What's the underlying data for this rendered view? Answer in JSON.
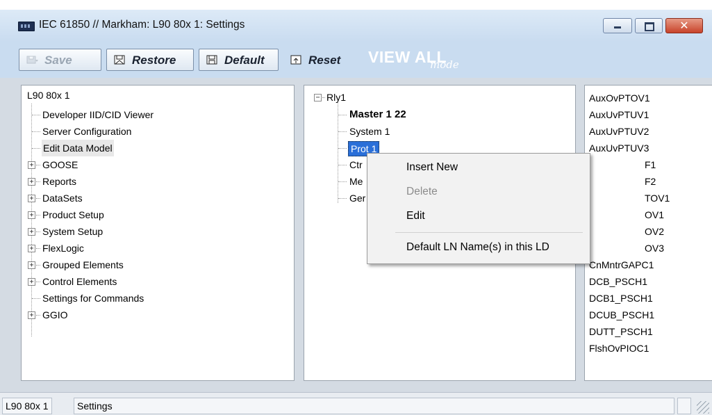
{
  "window": {
    "title": "IEC 61850 // Markham: L90 80x 1: Settings"
  },
  "toolbar": {
    "save": "Save",
    "restore": "Restore",
    "default": "Default",
    "reset": "Reset",
    "viewall_big": "VIEW ALL",
    "viewall_small": "mode"
  },
  "left_tree": {
    "root": "L90 80x 1",
    "items": [
      {
        "label": "Developer IID/CID Viewer",
        "expandable": false
      },
      {
        "label": "Server Configuration",
        "expandable": false
      },
      {
        "label": "Edit Data Model",
        "expandable": false,
        "selected": true
      },
      {
        "label": "GOOSE",
        "expandable": true
      },
      {
        "label": "Reports",
        "expandable": true
      },
      {
        "label": "DataSets",
        "expandable": true
      },
      {
        "label": "Product Setup",
        "expandable": true
      },
      {
        "label": "System Setup",
        "expandable": true
      },
      {
        "label": "FlexLogic",
        "expandable": true
      },
      {
        "label": "Grouped Elements",
        "expandable": true
      },
      {
        "label": "Control Elements",
        "expandable": true
      },
      {
        "label": "Settings for Commands",
        "expandable": false
      },
      {
        "label": "GGIO",
        "expandable": true
      }
    ]
  },
  "mid_tree": {
    "root": "Rly1",
    "items": [
      {
        "label": "Master  1 22",
        "style": "bold"
      },
      {
        "label": "System  1",
        "style": "normal"
      },
      {
        "label": "Prot  1",
        "style": "selected"
      },
      {
        "label": "Ctr",
        "style": "normal"
      },
      {
        "label": "Me",
        "style": "normal"
      },
      {
        "label": "Ger",
        "style": "normal"
      }
    ]
  },
  "right_list": {
    "items": [
      "AuxOvPTOV1",
      "AuxUvPTUV1",
      "AuxUvPTUV2",
      "AuxUvPTUV3",
      "F1",
      "F2",
      "TOV1",
      "OV1",
      "OV2",
      "OV3",
      "CnMntrGAPC1",
      "DCB_PSCH1",
      "DCB1_PSCH1",
      "DCUB_PSCH1",
      "DUTT_PSCH1",
      "FlshOvPIOC1"
    ]
  },
  "context_menu": {
    "insert_new": "Insert New",
    "delete": "Delete",
    "edit": "Edit",
    "default_ln": "Default LN Name(s) in this LD"
  },
  "statusbar": {
    "device": "L90 80x 1",
    "mode": "Settings"
  }
}
